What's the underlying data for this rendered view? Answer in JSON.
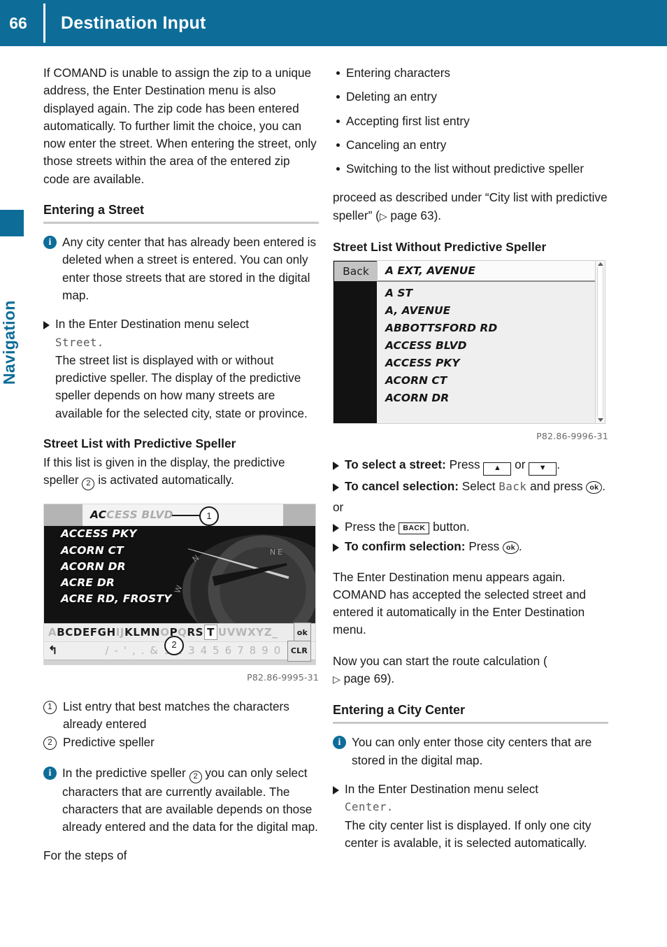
{
  "header": {
    "page_number": "66",
    "title": "Destination Input"
  },
  "side_tab": {
    "label": "Navigation"
  },
  "left_column": {
    "intro_paragraph": "If COMAND is unable to assign the zip to a unique address, the Enter Destination menu is also displayed again. The zip code has been entered automatically. To further limit the choice, you can now enter the street. When entering the street, only those streets within the area of the entered zip code are available.",
    "section_heading": "Entering a Street",
    "note_1": "Any city center that has already been entered is deleted when a street is entered. You can only enter those streets that are stored in the digital map.",
    "step_1_lead": "In the Enter Destination menu select",
    "step_1_command": "Street.",
    "step_1_body": "The street list is displayed with or without predictive speller. The display of the predictive speller depends on how many streets are available for the selected city, state or province.",
    "sub_heading": "Street List with Predictive Speller",
    "sub_paragraph_a": "If this list is given in the display, the predictive",
    "sub_paragraph_b": "speller",
    "sub_paragraph_callout": "2",
    "sub_paragraph_c": "is activated automatically.",
    "figure_caption": "P82.86-9995-31",
    "legend": [
      {
        "num": "1",
        "text": "List entry that best matches the characters already entered"
      },
      {
        "num": "2",
        "text": "Predictive speller"
      }
    ],
    "note_2_a": "In the predictive speller",
    "note_2_callout": "2",
    "note_2_b": "you can only select characters that are currently available. The characters that are available depends on those already entered and the data for the digital map.",
    "tail_paragraph": "For the steps of"
  },
  "figure_speller": {
    "entry_typed": "AC",
    "entry_rest": "CESS BLVD",
    "callout_1": "1",
    "callout_2": "2",
    "list_rows": [
      "ACCESS PKY",
      "ACORN CT",
      "ACORN DR",
      "ACRE DR",
      "ACRE RD, FROSTY"
    ],
    "compass_ne": "NE",
    "compass_n": "N",
    "compass_w": "W",
    "keyboard_letters": [
      {
        "ch": "A",
        "state": "off"
      },
      {
        "ch": "B",
        "state": "on"
      },
      {
        "ch": "C",
        "state": "on"
      },
      {
        "ch": "D",
        "state": "on"
      },
      {
        "ch": "E",
        "state": "on"
      },
      {
        "ch": "F",
        "state": "on"
      },
      {
        "ch": "G",
        "state": "on"
      },
      {
        "ch": "H",
        "state": "on"
      },
      {
        "ch": "I",
        "state": "off"
      },
      {
        "ch": "J",
        "state": "off"
      },
      {
        "ch": "K",
        "state": "on"
      },
      {
        "ch": "L",
        "state": "on"
      },
      {
        "ch": "M",
        "state": "on"
      },
      {
        "ch": "N",
        "state": "on"
      },
      {
        "ch": "O",
        "state": "off"
      },
      {
        "ch": "P",
        "state": "on"
      },
      {
        "ch": "Q",
        "state": "off"
      },
      {
        "ch": "R",
        "state": "on"
      },
      {
        "ch": "S",
        "state": "on"
      },
      {
        "ch": "T",
        "state": "selected"
      },
      {
        "ch": "U",
        "state": "off"
      },
      {
        "ch": "V",
        "state": "off"
      },
      {
        "ch": "W",
        "state": "off"
      },
      {
        "ch": "X",
        "state": "off"
      },
      {
        "ch": "Y",
        "state": "off"
      },
      {
        "ch": "Z",
        "state": "off"
      },
      {
        "ch": "_",
        "state": "off"
      }
    ],
    "ok_label": "ok",
    "clr_label": "CLR",
    "symbols_row": "/ - ' , . & 1 2 3 4 5 6 7 8 9 0",
    "back_glyph": "↰"
  },
  "right_column": {
    "bullets": [
      "Entering characters",
      "Deleting an entry",
      "Accepting first list entry",
      "Canceling an entry",
      "Switching to the list without predictive speller"
    ],
    "proceed_paragraph_a": "proceed as described under “City list with predictive speller” (",
    "proceed_page": "page 63",
    "proceed_paragraph_b": ").",
    "sub_heading": "Street List Without Predictive Speller",
    "figure_caption": "P82.86-9996-31",
    "step_select_label": "To select a street:",
    "step_select_press": "Press",
    "step_select_or": "or",
    "step_select_end": ".",
    "step_cancel_label": "To cancel selection:",
    "step_cancel_select": "Select",
    "step_cancel_command": "Back",
    "step_cancel_and": "and press",
    "step_cancel_ok": "ok",
    "step_cancel_end": ".",
    "or_word": "or",
    "step_back_a": "Press the",
    "step_back_button": "BACK",
    "step_back_b": "button.",
    "step_confirm_label": "To confirm selection:",
    "step_confirm_press": "Press",
    "step_confirm_ok": "ok",
    "step_confirm_end": ".",
    "result_paragraph": "The Enter Destination menu appears again. COMAND has accepted the selected street and entered it automatically in the Enter Destination menu.",
    "route_paragraph_a": "Now you can start the route calculation (",
    "route_page": "page 69",
    "route_paragraph_b": ").",
    "section_heading": "Entering a City Center",
    "note_1": "You can only enter those city centers that are stored in the digital map.",
    "step_1_lead": "In the Enter Destination menu select",
    "step_1_command": "Center.",
    "step_1_body": "The city center list is displayed. If only one city center is avalable, it is selected automatically."
  },
  "figure_list": {
    "back_label": "Back",
    "first_entry": "A EXT, AVENUE",
    "rows": [
      "A ST",
      "A, AVENUE",
      "ABBOTTSFORD RD",
      "ACCESS BLVD",
      "ACCESS PKY",
      "ACORN CT",
      "ACORN DR"
    ]
  },
  "colors": {
    "brand_teal": "#0d6d98",
    "text": "#1a1a1a",
    "lcd_gray": "#5a5a5a",
    "rule_gray": "#c8c8c8"
  }
}
